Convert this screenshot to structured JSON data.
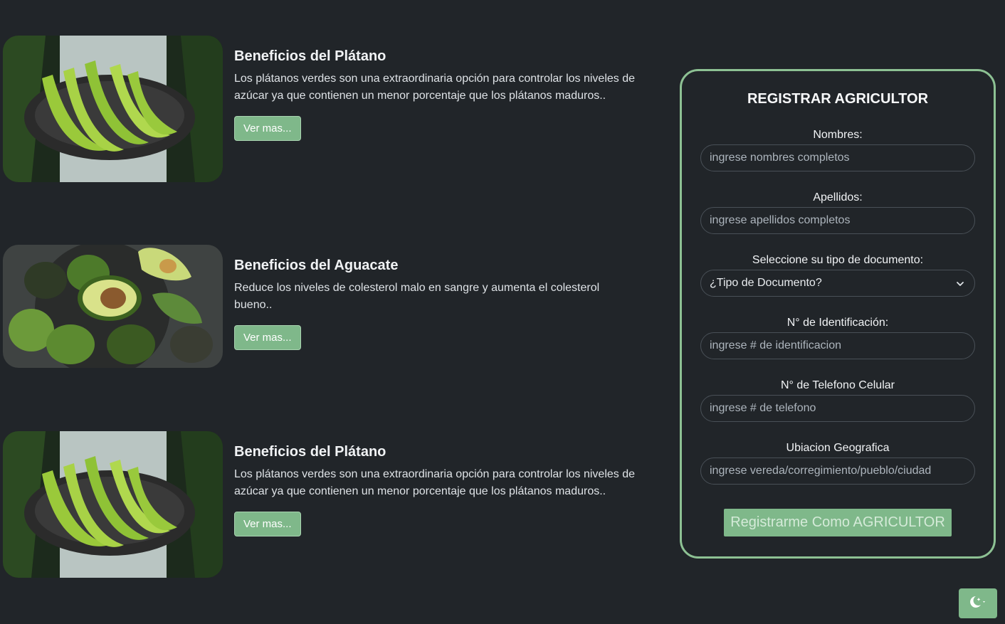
{
  "cards": [
    {
      "title": "Beneficios del Plátano",
      "text": "Los plátanos verdes son una extraordinaria opción para controlar los niveles de azúcar ya que contienen un menor porcentaje que los plátanos maduros..",
      "button": "Ver mas...",
      "image": "green-plantains-photo"
    },
    {
      "title": "Beneficios del Aguacate",
      "text": "Reduce los niveles de colesterol malo en sangre y aumenta el colesterol bueno..",
      "button": "Ver mas...",
      "image": "avocados-photo"
    },
    {
      "title": "Beneficios del Plátano",
      "text": "Los plátanos verdes son una extraordinaria opción para controlar los niveles de azúcar ya que contienen un menor porcentaje que los plátanos maduros..",
      "button": "Ver mas...",
      "image": "green-plantains-photo"
    }
  ],
  "form": {
    "title": "REGISTRAR AGRICULTOR",
    "fields": [
      {
        "label": "Nombres:",
        "placeholder": "ingrese nombres completos"
      },
      {
        "label": "Apellidos:",
        "placeholder": "ingrese apellidos completos"
      },
      {
        "label": "Seleccione su tipo de documento:",
        "selected": "¿Tipo de Documento?"
      },
      {
        "label": "N° de Identificación:",
        "placeholder": "ingrese # de identificacion"
      },
      {
        "label": "N° de Telefono Celular",
        "placeholder": "ingrese # de telefono"
      },
      {
        "label": "Ubiacion Geografica",
        "placeholder": "ingrese vereda/corregimiento/pueblo/ciudad"
      }
    ],
    "submit": "Registrarme Como AGRICULTOR"
  },
  "theme_toggle": {
    "icon": "moon-stars-icon"
  },
  "colors": {
    "background": "#212529",
    "accent": "#7fb88a",
    "panel_border": "#8dc193"
  }
}
